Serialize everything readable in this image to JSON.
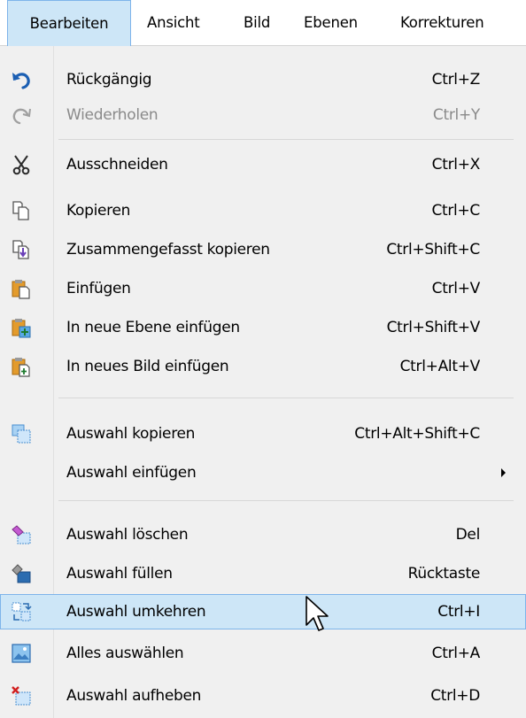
{
  "menubar": {
    "items": [
      {
        "label": "Bearbeiten"
      },
      {
        "label": "Ansicht"
      },
      {
        "label": "Bild"
      },
      {
        "label": "Ebenen"
      },
      {
        "label": "Korrekturen"
      }
    ]
  },
  "menu": {
    "items": [
      {
        "label": "Rückgängig",
        "shortcut": "Ctrl+Z",
        "icon": "undo-icon"
      },
      {
        "label": "Wiederholen",
        "shortcut": "Ctrl+Y",
        "icon": "redo-icon",
        "disabled": true
      },
      {
        "label": "Ausschneiden",
        "shortcut": "Ctrl+X",
        "icon": "scissors-icon"
      },
      {
        "label": "Kopieren",
        "shortcut": "Ctrl+C",
        "icon": "copy-icon"
      },
      {
        "label": "Zusammengefasst kopieren",
        "shortcut": "Ctrl+Shift+C",
        "icon": "copy-merged-icon"
      },
      {
        "label": "Einfügen",
        "shortcut": "Ctrl+V",
        "icon": "paste-icon"
      },
      {
        "label": "In neue Ebene einfügen",
        "shortcut": "Ctrl+Shift+V",
        "icon": "paste-new-layer-icon"
      },
      {
        "label": "In neues Bild einfügen",
        "shortcut": "Ctrl+Alt+V",
        "icon": "paste-new-image-icon"
      },
      {
        "label": "Auswahl kopieren",
        "shortcut": "Ctrl+Alt+Shift+C",
        "icon": "copy-selection-icon"
      },
      {
        "label": "Auswahl einfügen",
        "shortcut": "",
        "icon": "",
        "submenu": true
      },
      {
        "label": "Auswahl löschen",
        "shortcut": "Del",
        "icon": "eraser-selection-icon"
      },
      {
        "label": "Auswahl füllen",
        "shortcut": "Rücktaste",
        "icon": "fill-selection-icon"
      },
      {
        "label": "Auswahl umkehren",
        "shortcut": "Ctrl+I",
        "icon": "invert-selection-icon",
        "highlighted": true
      },
      {
        "label": "Alles auswählen",
        "shortcut": "Ctrl+A",
        "icon": "select-all-icon"
      },
      {
        "label": "Auswahl aufheben",
        "shortcut": "Ctrl+D",
        "icon": "deselect-icon"
      }
    ]
  },
  "colors": {
    "highlight_bg": "#cde6f7",
    "highlight_border": "#7eb4ea",
    "menu_bg": "#f0f0f0",
    "disabled_text": "#8a8a8a"
  }
}
